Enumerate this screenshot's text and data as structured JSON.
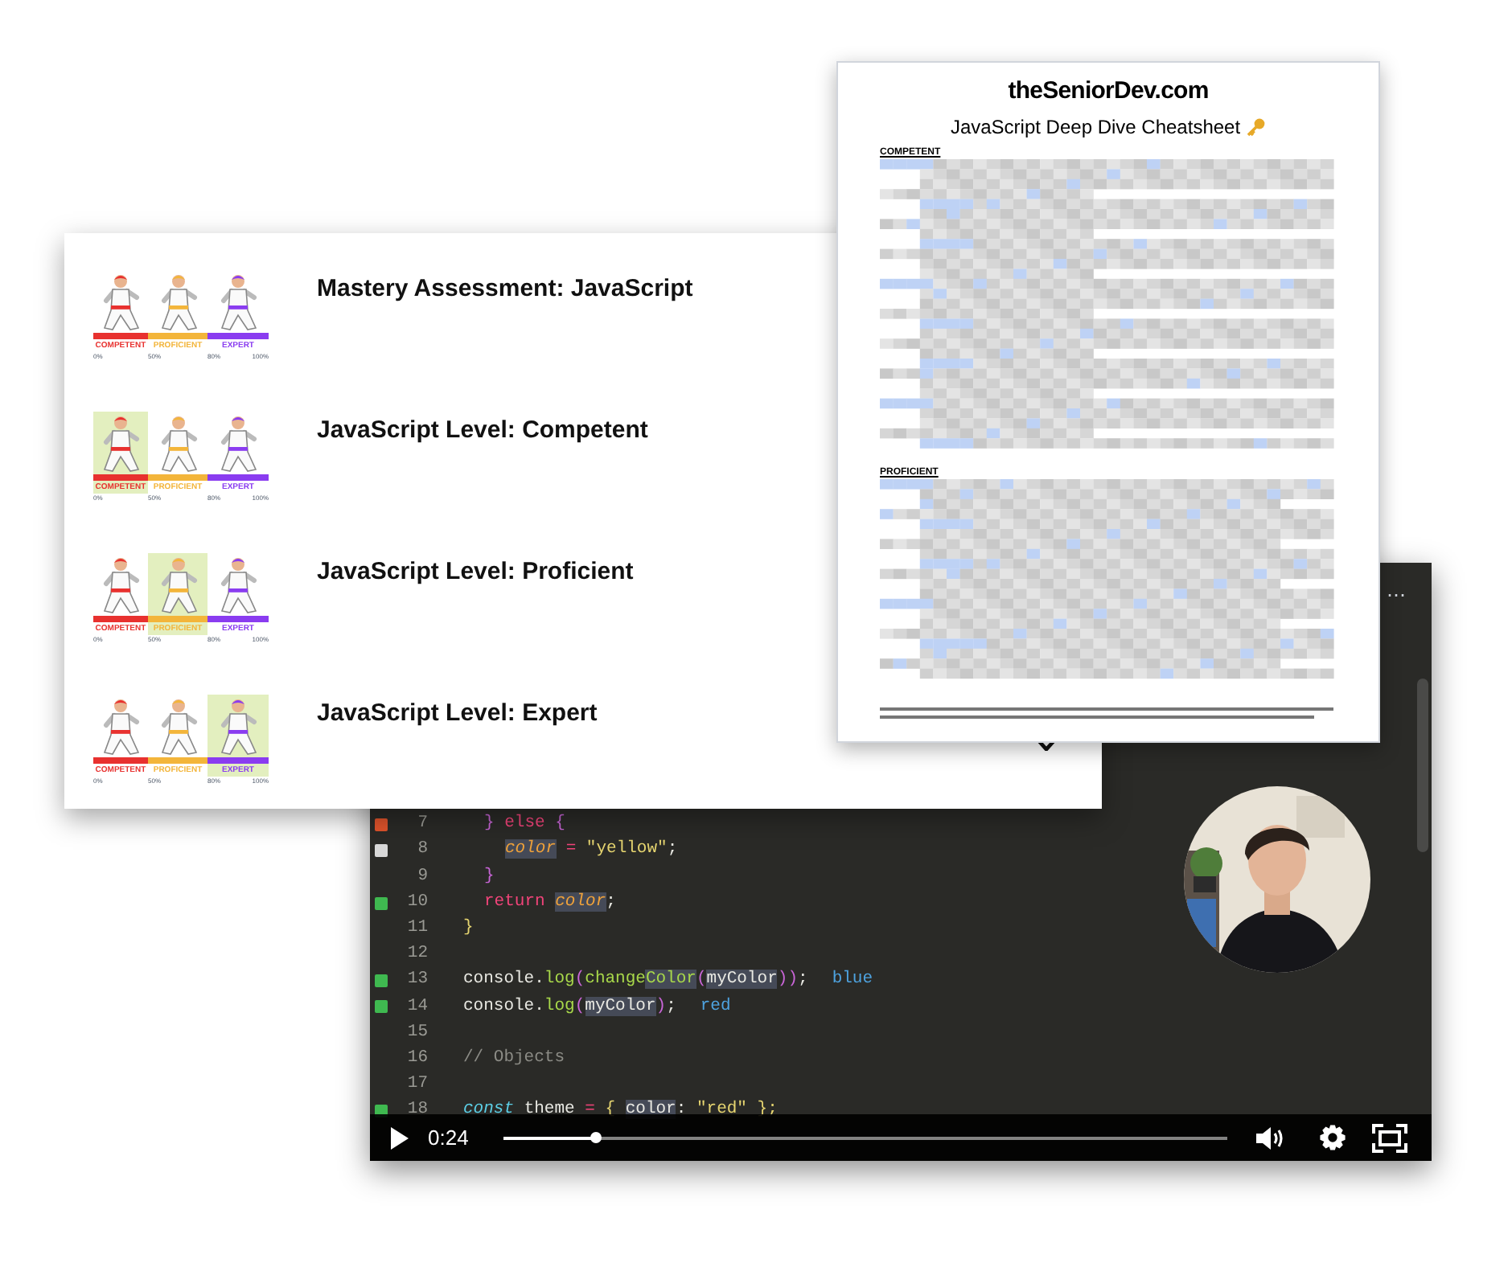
{
  "slide": {
    "rows": [
      {
        "title": "Mastery Assessment: JavaScript",
        "levels": [
          {
            "label": "COMPETENT",
            "color": "#e8312f",
            "selected": false
          },
          {
            "label": "PROFICIENT",
            "color": "#f3b53a",
            "selected": false
          },
          {
            "label": "EXPERT",
            "color": "#8a3cf0",
            "selected": false
          }
        ],
        "ticks": [
          "0%",
          "50%",
          "80%",
          "100%"
        ]
      },
      {
        "title": "JavaScript Level: Competent",
        "levels": [
          {
            "label": "COMPETENT",
            "color": "#e8312f",
            "selected": true
          },
          {
            "label": "PROFICIENT",
            "color": "#f3b53a",
            "selected": false
          },
          {
            "label": "EXPERT",
            "color": "#8a3cf0",
            "selected": false
          }
        ],
        "ticks": [
          "0%",
          "50%",
          "80%",
          "100%"
        ]
      },
      {
        "title": "JavaScript Level: Proficient",
        "levels": [
          {
            "label": "COMPETENT",
            "color": "#e8312f",
            "selected": false
          },
          {
            "label": "PROFICIENT",
            "color": "#f3b53a",
            "selected": true
          },
          {
            "label": "EXPERT",
            "color": "#8a3cf0",
            "selected": false
          }
        ],
        "ticks": [
          "0%",
          "50%",
          "80%",
          "100%"
        ]
      },
      {
        "title": "JavaScript Level: Expert",
        "levels": [
          {
            "label": "COMPETENT",
            "color": "#e8312f",
            "selected": false
          },
          {
            "label": "PROFICIENT",
            "color": "#f3b53a",
            "selected": false
          },
          {
            "label": "EXPERT",
            "color": "#8a3cf0",
            "selected": true
          }
        ],
        "ticks": [
          "0%",
          "50%",
          "80%",
          "100%"
        ]
      }
    ]
  },
  "cheatsheet": {
    "logo": "theSeniorDev.com",
    "title": "JavaScript Deep Dive Cheatsheet",
    "sections": [
      {
        "heading": "COMPETENT"
      },
      {
        "heading": "PROFICIENT"
      }
    ]
  },
  "video": {
    "code_lines": [
      {
        "number": "7",
        "color": "#e0542c",
        "kind": "inner",
        "tokens": [
          {
            "text": "} ",
            "kind": "brace",
            "highlighted": false
          },
          {
            "text": "else",
            "kind": "keyword",
            "highlighted": false
          },
          {
            "text": " {",
            "kind": "brace",
            "highlighted": false
          }
        ]
      },
      {
        "number": "8",
        "color": "#d8d8d8",
        "kind": "innermost",
        "tokens": [
          {
            "text": "color",
            "kind": "variable",
            "highlighted": true
          },
          {
            "text": " = ",
            "kind": "keyword",
            "highlighted": false
          },
          {
            "text": "\"yellow\"",
            "kind": "string",
            "highlighted": false
          },
          {
            "text": ";",
            "kind": "plain",
            "highlighted": false
          }
        ]
      },
      {
        "number": "9",
        "kind": "inner",
        "tokens": [
          {
            "text": "}",
            "kind": "brace",
            "highlighted": false
          }
        ]
      },
      {
        "number": "10",
        "color": "#3fb950",
        "kind": "inner",
        "tokens": [
          {
            "text": "return ",
            "kind": "keyword",
            "highlighted": false
          },
          {
            "text": "color",
            "kind": "variable",
            "highlighted": true
          },
          {
            "text": ";",
            "kind": "plain",
            "highlighted": false
          }
        ]
      },
      {
        "number": "11",
        "kind": "top",
        "tokens": [
          {
            "text": "}",
            "kind": "string",
            "highlighted": false
          }
        ]
      },
      {
        "number": "12"
      },
      {
        "number": "13",
        "kind": "top",
        "color": "#3fb950",
        "tokens": [
          {
            "text": "console.",
            "kind": "plain",
            "highlighted": false
          },
          {
            "text": "log",
            "kind": "func",
            "highlighted": false
          },
          {
            "text": "(",
            "kind": "brace",
            "highlighted": false
          },
          {
            "text": "change",
            "kind": "func",
            "highlighted": false
          },
          {
            "text": "Color",
            "kind": "func",
            "highlighted": true
          },
          {
            "text": "(",
            "kind": "brace",
            "highlighted": false
          },
          {
            "text": "myColor",
            "kind": "plain",
            "highlighted": true
          },
          {
            "text": "))",
            "kind": "brace",
            "highlighted": false
          },
          {
            "text": ";",
            "kind": "plain",
            "highlighted": false
          }
        ],
        "output": "blue"
      },
      {
        "number": "14",
        "kind": "top",
        "color": "#3fb950",
        "tokens": [
          {
            "text": "console.",
            "kind": "plain",
            "highlighted": false
          },
          {
            "text": "log",
            "kind": "func",
            "highlighted": false
          },
          {
            "text": "(",
            "kind": "brace",
            "highlighted": false
          },
          {
            "text": "myColor",
            "kind": "plain",
            "highlighted": true
          },
          {
            "text": ")",
            "kind": "brace",
            "highlighted": false
          },
          {
            "text": ";",
            "kind": "plain",
            "highlighted": false
          }
        ],
        "output": "red"
      },
      {
        "number": "15"
      },
      {
        "number": "16",
        "kind": "top",
        "tokens": [
          {
            "text": "// Objects",
            "kind": "comment",
            "highlighted": false
          }
        ]
      },
      {
        "number": "17"
      },
      {
        "number": "18",
        "kind": "top",
        "color": "#3fb950",
        "tokens": [
          {
            "text": "const",
            "kind": "storage",
            "highlighted": false
          },
          {
            "text": " theme ",
            "kind": "plain",
            "highlighted": false
          },
          {
            "text": "=",
            "kind": "keyword",
            "highlighted": false
          },
          {
            "text": " { ",
            "kind": "string",
            "highlighted": false
          },
          {
            "text": "color",
            "kind": "plain",
            "highlighted": true
          },
          {
            "text": ": ",
            "kind": "plain",
            "highlighted": false
          },
          {
            "text": "\"red\"",
            "kind": "string",
            "highlighted": false
          },
          {
            "text": " };",
            "kind": "string",
            "highlighted": false
          }
        ]
      }
    ],
    "more_glyph": "⋯",
    "player": {
      "time": "0:24",
      "level": 0.127
    }
  }
}
